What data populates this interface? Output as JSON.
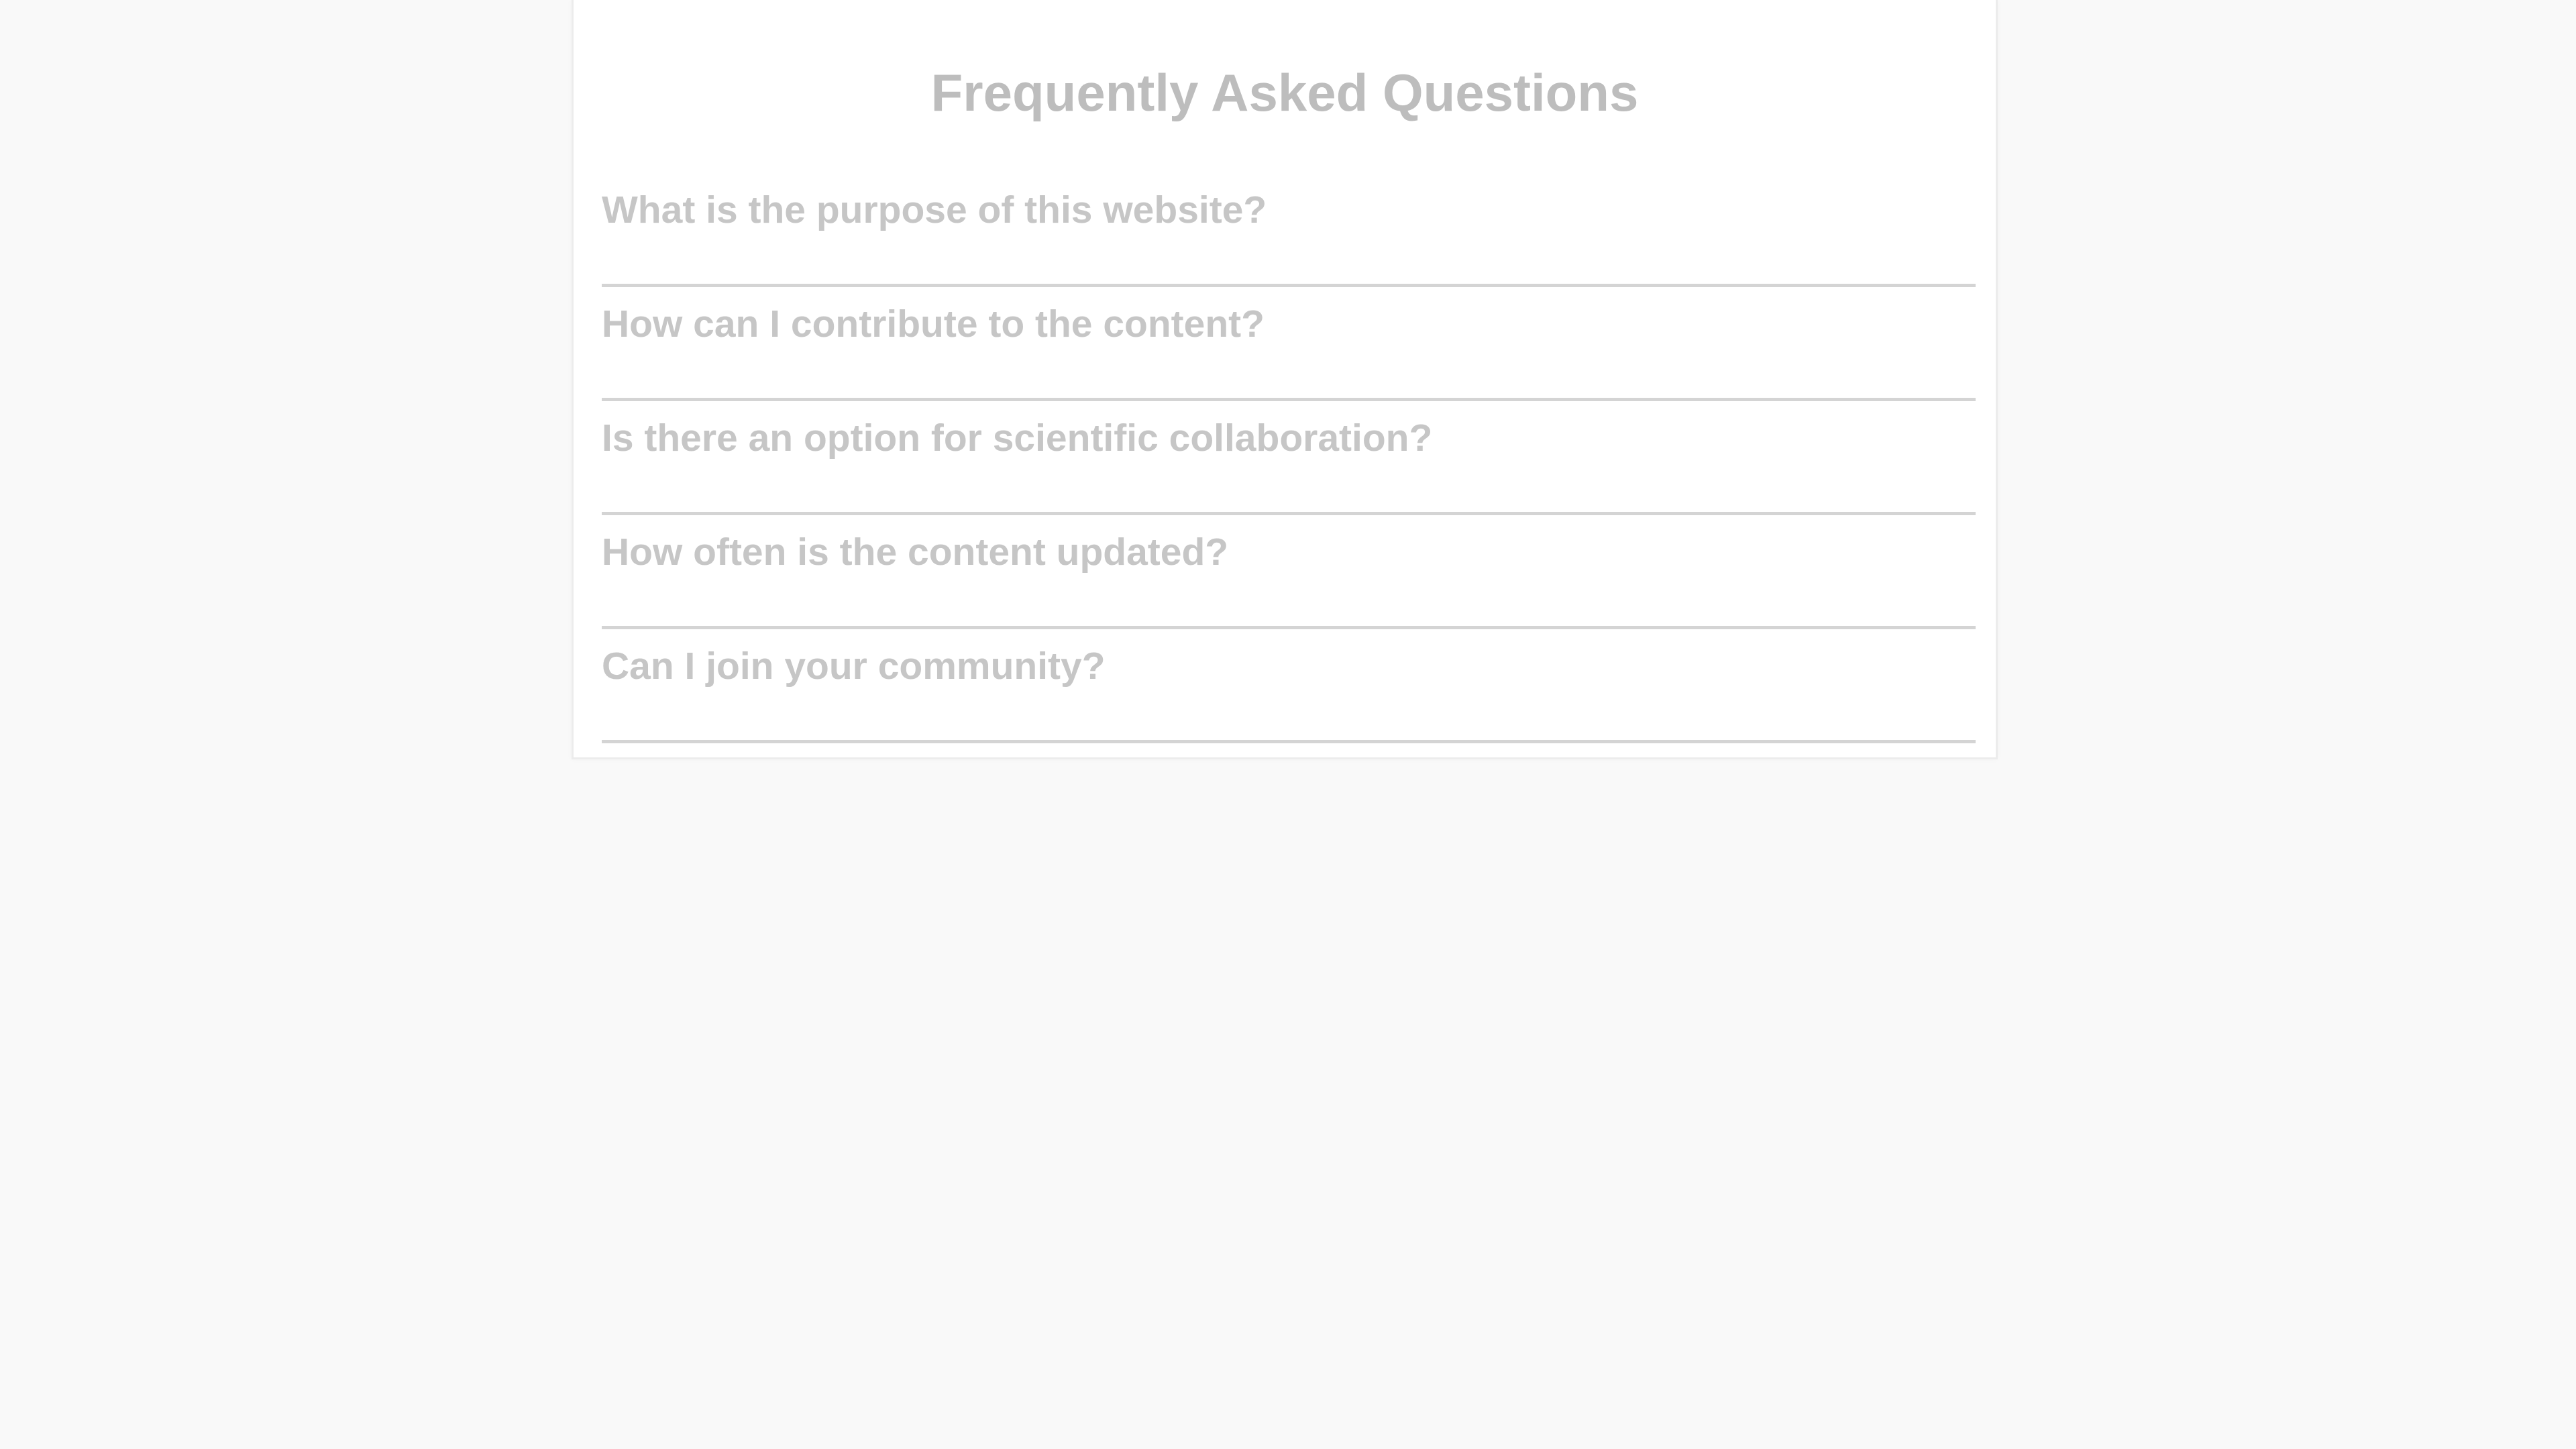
{
  "faq": {
    "title": "Frequently Asked Questions",
    "questions": [
      {
        "text": "What is the purpose of this website?"
      },
      {
        "text": "How can I contribute to the content?"
      },
      {
        "text": "Is there an option for scientific collaboration?"
      },
      {
        "text": "How often is the content updated?"
      },
      {
        "text": "Can I join your community?"
      }
    ]
  },
  "colors": {
    "background": "#f9f9f9",
    "card": "#ffffff",
    "title_text": "#bdbdbd",
    "question_text": "#c6c6c6",
    "divider": "#d4d4d4"
  }
}
